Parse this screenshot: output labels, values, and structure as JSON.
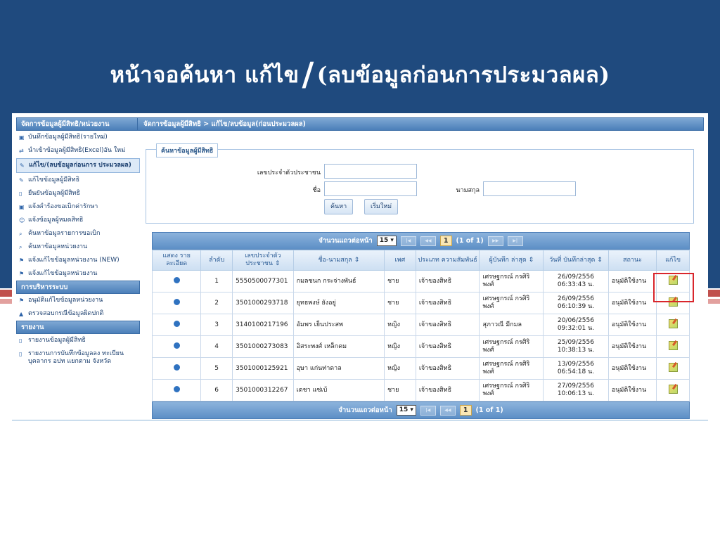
{
  "slide": {
    "title_part1": "หน้าจอค้นหา แก้ไข",
    "title_slash": "/",
    "title_part2": "(ลบข้อมูลก่อนการประมวลผล)"
  },
  "colors": {
    "band": "#1f4a7e",
    "accent_red": "#d9262c",
    "header_blue": "#4b7fb9"
  },
  "sidebar": {
    "section1": "จัดการข้อมูลผู้มีสิทธิ/หน่วยงาน",
    "items1": [
      {
        "icon": "save-icon",
        "label": "บันทึกข้อมูลผู้มีสิทธิ(รายใหม่)"
      },
      {
        "icon": "import-icon",
        "label": "นำเข้าข้อมูลผู้มีสิทธิ(Excel)อัน ใหม่"
      },
      {
        "icon": "pencil-icon",
        "label": "แก้ไข/(ลบข้อมูลก่อนการ ประมวลผล)"
      },
      {
        "icon": "pencil-icon",
        "label": "แก้ไขข้อมูลผู้มีสิทธิ"
      },
      {
        "icon": "document-icon",
        "label": "ยืนยันข้อมูลผู้มีสิทธิ"
      },
      {
        "icon": "save-icon",
        "label": "แจ้งคำร้องขอเบิกค่ารักษา"
      },
      {
        "icon": "user-icon",
        "label": "แจ้งข้อมูลผู้หมดสิทธิ"
      },
      {
        "icon": "search-icon",
        "label": "ค้นหาข้อมูลรายการขอเบิก"
      },
      {
        "icon": "search-icon",
        "label": "ค้นหาข้อมูลหน่วยงาน"
      },
      {
        "icon": "flag-icon",
        "label": "แจ้งแก้ไขข้อมูลหน่วยงาน (NEW)"
      },
      {
        "icon": "flag-icon",
        "label": "แจ้งแก้ไขข้อมูลหน่วยงาน"
      }
    ],
    "section2": "การบริหารระบบ",
    "items2": [
      {
        "icon": "flag-icon",
        "label": "อนุมัติแก้ไขข้อมูลหน่วยงาน"
      },
      {
        "icon": "warning-icon",
        "label": "ตรวจสอบกรณีข้อมูลผิดปกติ"
      }
    ],
    "section3": "รายงาน",
    "items3": [
      {
        "icon": "document-icon",
        "label": "รายงานข้อมูลผู้มีสิทธิ"
      },
      {
        "icon": "document-icon",
        "label": "รายงานการบันทึกข้อมูลลง ทะเบียนบุคลากร อปท แยกตาม จังหวัด"
      }
    ]
  },
  "main": {
    "breadcrumb": "จัดการข้อมูลผู้มีสิทธิ > แก้ไข/ลบข้อมูล(ก่อนประมวลผล)",
    "search": {
      "legend": "ค้นหาข้อมูลผู้มีสิทธิ",
      "id_label": "เลขประจำตัวประชาชน",
      "name_label": "ชื่อ",
      "surname_label": "นามสกุล",
      "id_value": "",
      "name_value": "",
      "surname_value": "",
      "search_button": "ค้นหา",
      "reset_button": "เริ่มใหม่"
    },
    "pager": {
      "rows_label": "จำนวนแถวต่อหน้า",
      "rows_value": "15",
      "current_page": "1",
      "page_info": "(1 of 1)"
    },
    "table": {
      "headers": [
        "แสดง รายละเอียด",
        "ลำดับ",
        "เลขประจำตัว ประชาชน ⇕",
        "ชื่อ-นามสกุล ⇕",
        "เพศ",
        "ประเภท ความสัมพันธ์",
        "ผู้บันทึก ล่าสุด ⇕",
        "วันที่ บันทึกล่าสุด ⇕",
        "สถานะ",
        "แก้ไข"
      ],
      "rows": [
        {
          "no": "1",
          "pid": "5550500077301",
          "name": "กมลชนก กระจ่างพันธ์",
          "sex": "ชาย",
          "relation": "เจ้าของสิทธิ",
          "recorder": "เศรษฐกรณ์ กรศิริ พงศ์",
          "date": "26/09/2556 06:33:43 น.",
          "status": "อนุมัติใช้งาน"
        },
        {
          "no": "2",
          "pid": "3501000293718",
          "name": "ยุทธพงษ์ ยังอยู่",
          "sex": "ชาย",
          "relation": "เจ้าของสิทธิ",
          "recorder": "เศรษฐกรณ์ กรศิริ พงศ์",
          "date": "26/09/2556 06:10:39 น.",
          "status": "อนุมัติใช้งาน"
        },
        {
          "no": "3",
          "pid": "3140100217196",
          "name": "อัมพร เย็นประสพ",
          "sex": "หญิง",
          "relation": "เจ้าของสิทธิ",
          "recorder": "สุภาวณี มีกมล",
          "date": "20/06/2556 09:32:01 น.",
          "status": "อนุมัติใช้งาน"
        },
        {
          "no": "4",
          "pid": "3501000273083",
          "name": "อิสระพงศ์ เหล็กคม",
          "sex": "หญิง",
          "relation": "เจ้าของสิทธิ",
          "recorder": "เศรษฐกรณ์ กรศิริ พงศ์",
          "date": "25/09/2556 10:38:13 น.",
          "status": "อนุมัติใช้งาน"
        },
        {
          "no": "5",
          "pid": "3501000125921",
          "name": "อุษา แก่นท่าดาล",
          "sex": "หญิง",
          "relation": "เจ้าของสิทธิ",
          "recorder": "เศรษฐกรณ์ กรศิริ พงศ์",
          "date": "13/09/2556 06:54:18 น.",
          "status": "อนุมัติใช้งาน"
        },
        {
          "no": "6",
          "pid": "3501000312267",
          "name": "เดชา แซ่เบ้",
          "sex": "ชาย",
          "relation": "เจ้าของสิทธิ",
          "recorder": "เศรษฐกรณ์ กรศิริ พงศ์",
          "date": "27/09/2556 10:06:13 น.",
          "status": "อนุมัติใช้งาน"
        }
      ]
    }
  }
}
